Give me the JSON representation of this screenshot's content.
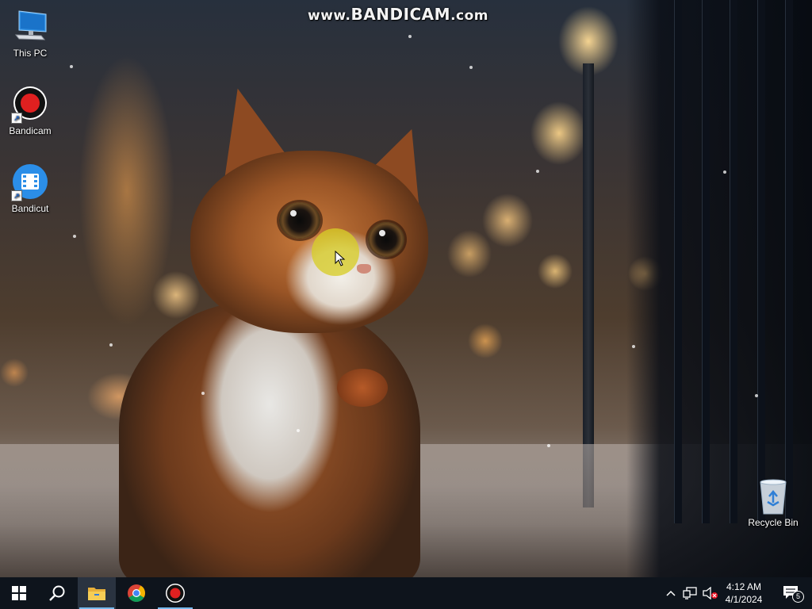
{
  "watermark": {
    "prefix": "www.",
    "brand": "BANDICAM",
    "suffix": ".com"
  },
  "desktop_icons": [
    {
      "label": "This PC",
      "icon": "this-pc-icon"
    },
    {
      "label": "Bandicam",
      "icon": "bandicam-icon",
      "shortcut": true
    },
    {
      "label": "Bandicut",
      "icon": "bandicut-icon",
      "shortcut": true
    },
    {
      "label": "Recycle Bin",
      "icon": "recycle-bin-icon"
    }
  ],
  "taskbar": {
    "start": "windows-start-icon",
    "search": "search-icon",
    "pinned": [
      {
        "name": "file-explorer",
        "icon": "folder-icon",
        "active": true,
        "highlight": true
      },
      {
        "name": "chrome",
        "icon": "chrome-icon",
        "active": false
      },
      {
        "name": "bandicam",
        "icon": "bandicam-icon",
        "active": true
      }
    ],
    "tray": {
      "icons": [
        "chevron-up-icon",
        "network-icon",
        "volume-muted-icon"
      ],
      "time": "4:12 AM",
      "date": "4/1/2024",
      "notification_count": "5"
    }
  },
  "colors": {
    "taskbar": "#0e141c",
    "active_indicator": "#76b9ed",
    "bandicam_red": "#e02020",
    "cursor_highlight": "#d7cd28"
  }
}
